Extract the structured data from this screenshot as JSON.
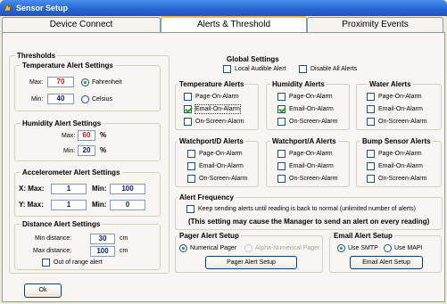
{
  "window": {
    "title": "Sensor Setup"
  },
  "tabs": [
    {
      "label": "Device Connect"
    },
    {
      "label": "Alerts & Threshold"
    },
    {
      "label": "Proximity Events"
    }
  ],
  "thresholds": {
    "title": "Thresholds",
    "temperature": {
      "title": "Temperature Alert Settings",
      "max_label": "Max:",
      "max_value": "70",
      "min_label": "Min:",
      "min_value": "40",
      "fahrenheit_label": "Fahrenheit",
      "celsius_label": "Celsius"
    },
    "humidity": {
      "title": "Humidity Alert Settings",
      "max_label": "Max:",
      "max_value": "60",
      "min_label": "Min:",
      "min_value": "20",
      "unit": "%"
    },
    "accelerometer": {
      "title": "Accelerometer Alert Settings",
      "x_label": "X: Max:",
      "x_max": "1",
      "x_min_label": "Min:",
      "x_min": "100",
      "y_label": "Y: Max:",
      "y_max": "1",
      "y_min_label": "Min:",
      "y_min": "0"
    },
    "distance": {
      "title": "Distance Alert Settings",
      "min_label": "Min distance:",
      "min_value": "30",
      "min_unit": "cm",
      "max_label": "Max distance:",
      "max_value": "100",
      "max_unit": "cm",
      "out_of_range_label": "Out of range alert"
    }
  },
  "global_settings": {
    "title": "Global Settings",
    "local_audible_label": "Local Audible Alert",
    "disable_all_label": "Disable All Alerts"
  },
  "alert_groups": [
    {
      "title": "Temperature Alerts",
      "options": [
        {
          "label": "Page-On-Alarm",
          "checked": false
        },
        {
          "label": "Email-On-Alarm",
          "checked": true
        },
        {
          "label": "On-Screen-Alarm",
          "checked": false
        }
      ]
    },
    {
      "title": "Humidity Alerts",
      "options": [
        {
          "label": "Page-On-Alarm",
          "checked": false
        },
        {
          "label": "Email-On-Alarm",
          "checked": true
        },
        {
          "label": "On-Screen-Alarm",
          "checked": false
        }
      ]
    },
    {
      "title": "Water Alerts",
      "options": [
        {
          "label": "Page-On-Alarm",
          "checked": false
        },
        {
          "label": "Email-On-Alarm",
          "checked": false
        },
        {
          "label": "On-Screen-Alarm",
          "checked": false
        }
      ]
    },
    {
      "title": "Watchport/D Alerts",
      "options": [
        {
          "label": "Page-On-Alarm",
          "checked": false
        },
        {
          "label": "Email-On-Alarm",
          "checked": false
        },
        {
          "label": "On-Screen-Alarm",
          "checked": false
        }
      ]
    },
    {
      "title": "Watchport/A Alerts",
      "options": [
        {
          "label": "Page-On-Alarm",
          "checked": false
        },
        {
          "label": "Email-On-Alarm",
          "checked": false
        },
        {
          "label": "On-Screen-Alarm",
          "checked": false
        }
      ]
    },
    {
      "title": "Bump Sensor Alerts",
      "options": [
        {
          "label": "Page-On-Alarm",
          "checked": false
        },
        {
          "label": "Email-On-Alarm",
          "checked": false
        },
        {
          "label": "On-Screen-Alarm",
          "checked": false
        }
      ]
    }
  ],
  "alert_frequency": {
    "title": "Alert Frequency",
    "keep_sending_label": "Keep sending alerts until reading is back to normal (unlimited number of alerts)",
    "warning": "(This setting may cause the Manager to send an alert on every reading)"
  },
  "pager": {
    "title": "Pager Alert Setup",
    "numerical_label": "Numerical Pager",
    "alpha_label": "Alpha-Numerical Pager",
    "button_label": "Pager Alert Setup"
  },
  "email": {
    "title": "Email Alert Setup",
    "smtp_label": "Use SMTP",
    "mapi_label": "Use MAPI",
    "button_label": "Email Alert Setup"
  },
  "footer": {
    "ok_label": "Ok"
  },
  "colors": {
    "title_bar": "#2766d6",
    "active_tab_highlight": "#f7b64b",
    "alert_value": "#d01818",
    "check": "#21a121"
  }
}
